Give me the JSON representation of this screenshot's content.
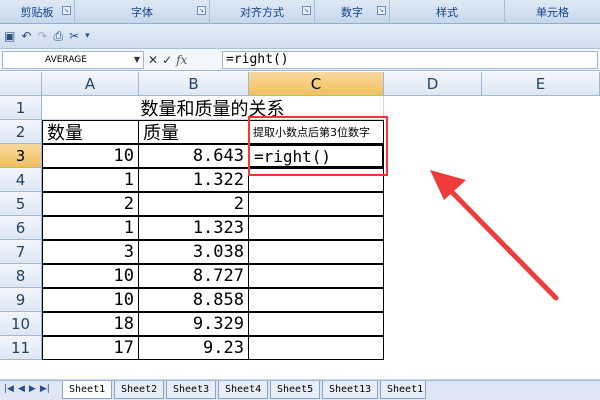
{
  "ribbon": {
    "groups": [
      "剪贴板",
      "字体",
      "对齐方式",
      "数字",
      "样式",
      "单元格"
    ]
  },
  "formula_bar": {
    "name_box": "AVERAGE",
    "formula": "=right()"
  },
  "columns": [
    "A",
    "B",
    "C",
    "D",
    "E"
  ],
  "rows": [
    "1",
    "2",
    "3",
    "4",
    "5",
    "6",
    "7",
    "8",
    "9",
    "10",
    "11"
  ],
  "sheet": {
    "title": "数量和质量的关系",
    "header_a": "数量",
    "header_b": "质量",
    "header_c": "提取小数点后第3位数字",
    "active_cell_text": "=right()",
    "data": [
      {
        "a": "10",
        "b": "8.643"
      },
      {
        "a": "1",
        "b": "1.322"
      },
      {
        "a": "2",
        "b": "2"
      },
      {
        "a": "1",
        "b": "1.323"
      },
      {
        "a": "3",
        "b": "3.038"
      },
      {
        "a": "10",
        "b": "8.727"
      },
      {
        "a": "10",
        "b": "8.858"
      },
      {
        "a": "18",
        "b": "9.329"
      },
      {
        "a": "17",
        "b": "9.23"
      }
    ]
  },
  "tabs": [
    "Sheet1",
    "Sheet2",
    "Sheet3",
    "Sheet4",
    "Sheet5",
    "Sheet13",
    "Sheet1"
  ],
  "colors": {
    "highlight": "#ff3333",
    "arrow": "#ee3b3b"
  }
}
